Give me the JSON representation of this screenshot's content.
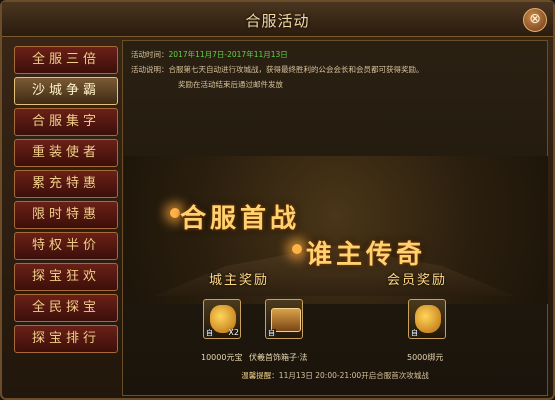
{
  "window": {
    "title": "合服活动",
    "close_label": "⊗"
  },
  "sidebar": {
    "items": [
      {
        "label": "全服三倍"
      },
      {
        "label": "沙城争霸"
      },
      {
        "label": "合服集字"
      },
      {
        "label": "重装使者"
      },
      {
        "label": "累充特惠"
      },
      {
        "label": "限时特惠"
      },
      {
        "label": "特权半价"
      },
      {
        "label": "探宝狂欢"
      },
      {
        "label": "全民探宝"
      },
      {
        "label": "探宝排行"
      }
    ],
    "active_index": 1
  },
  "info": {
    "time_label": "活动时间：",
    "time_value": "2017年11月7日-2017年11月13日",
    "desc_label": "活动说明：",
    "desc_line1": "合服第七天自动进行攻城战，获得最终胜利的公会会长和会员都可获得奖励。",
    "desc_line2": "奖励在活动结束后通过邮件发放"
  },
  "banner": {
    "line1": "合服首战",
    "line2": "谁主传奇"
  },
  "rewards": {
    "lord_title": "城主奖励",
    "member_title": "会员奖励",
    "item_tag": "自",
    "lord_items": [
      {
        "icon": "gold-bag-icon",
        "qty": "X2",
        "caption": "10000元宝"
      },
      {
        "icon": "treasure-chest-icon",
        "qty": "",
        "caption": "伏羲首饰箱子·法"
      }
    ],
    "member_items": [
      {
        "icon": "gold-bag-icon",
        "qty": "",
        "caption": "5000绑元"
      }
    ]
  },
  "notice": {
    "label": "温馨提醒：",
    "text": "11月13日 20:00-21:00开启合服首次攻城战"
  }
}
